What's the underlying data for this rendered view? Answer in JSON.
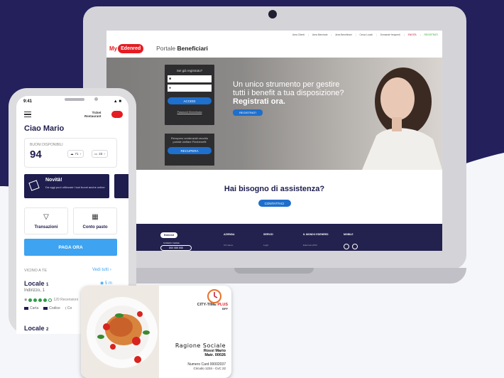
{
  "laptop": {
    "topnav": [
      "Area Clienti",
      "Area Merchant",
      "Area Beneficiari",
      "Cerca Locali",
      "Domande frequenti",
      "ENGITA",
      "REGISTRATI"
    ],
    "logo_text": "My",
    "logo_brand": "Edenred",
    "portal_label": "Portale",
    "portal_bold": "Beneficiari",
    "login": {
      "title": "Sei già registrato?",
      "user_icon": "user-icon",
      "password_icon": "key-icon",
      "button": "ACCEDI",
      "forgot": "Password Dimenticata"
    },
    "recover": {
      "text": "Recupero credenziali vecchio portale welfare Flexbenefit",
      "button": "RECUPERA"
    },
    "hero": {
      "line1": "Un unico strumento per gestire",
      "line2": "tutti i benefit a tua disposizione?",
      "line3": "Registrati ora.",
      "button": "REGISTRATI"
    },
    "assist": {
      "title": "Hai bisogno di assistenza?",
      "button": "CONTATTACI"
    },
    "footer": {
      "logo": "Edenred",
      "phone_label": "NUMERO VERDE",
      "phone": "800 085 558",
      "col_azienda": "AZIENDA",
      "col_azienda_sub": "Chi siamo",
      "col_servizi": "SERVIZI",
      "col_servizi_sub": "Login",
      "col_mondo": "IL MONDO EDENRED",
      "col_mondo_sub": "Edenred.ePOV",
      "col_mobile": "MOBILE"
    }
  },
  "phone": {
    "time": "9:41",
    "brand_line1": "Ticket",
    "brand_line2": "Restaurant",
    "greeting": "Ciao Mario",
    "buoni_label": "BUONI DISPONIBILI",
    "buoni_value": "94",
    "pill_cloud": "71",
    "pill_card": "23",
    "novita_title": "Novità!",
    "novita_text": "Da oggi puoi utilizzare i tuoi buoni anche online",
    "tile_transazioni": "Transazioni",
    "tile_conto": "Conto pasto",
    "paga": "PAGA ORA",
    "vicino": "VICINO A TE",
    "vedi": "Vedi tutti",
    "locale1": "Locale",
    "locale1_num": "1",
    "locale1_dist": "5 m",
    "address": "Indirizzo, 1",
    "reviews": "120 Recensioni",
    "tag1": "Carta",
    "tag2": "Codice",
    "tag3": "Co",
    "locale2": "Locale",
    "locale2_num": "2"
  },
  "card": {
    "brand": "CITY-TIME",
    "brand_plus": "PLUS",
    "bpf": "BPF",
    "ragione": "Ragione Sociale",
    "name": "Rossi Mario",
    "matr": "Matr. 00026",
    "numero": "Numero Card 00002037",
    "circuito": "Circuito 1234 - CvC 22"
  },
  "colors": {
    "navy": "#1e1d4e",
    "blue": "#1f6fcc",
    "light_blue": "#3ea3f0",
    "red": "#e41c23"
  }
}
